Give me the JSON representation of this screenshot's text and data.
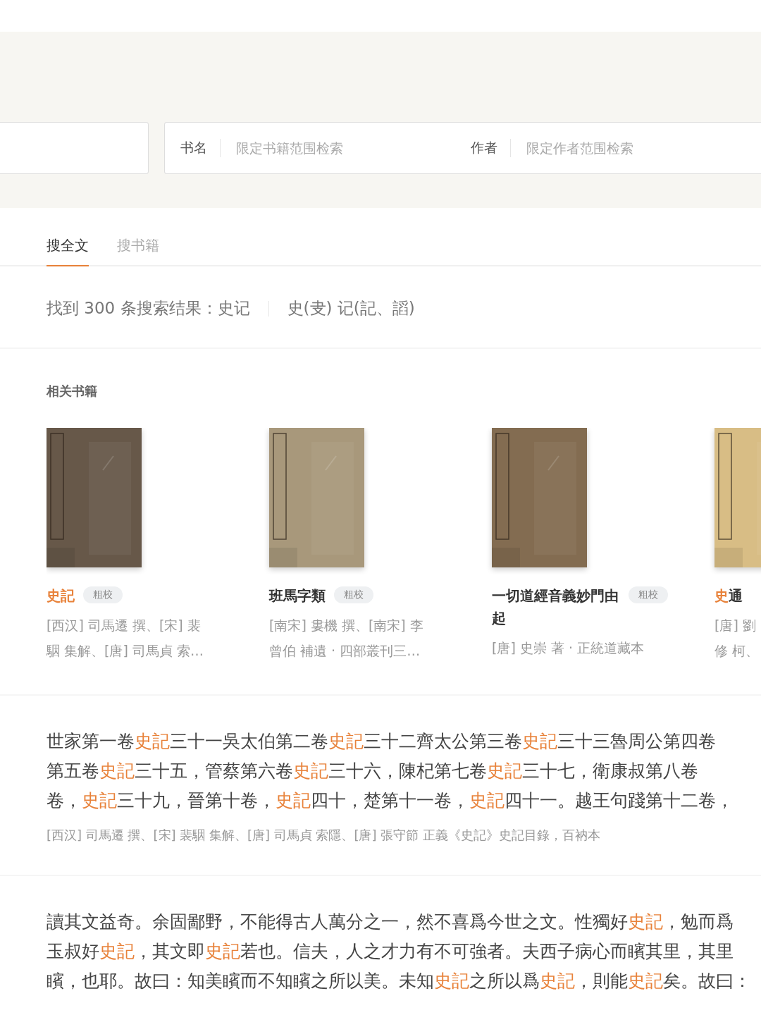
{
  "search": {
    "fields": [
      {
        "label": "书名",
        "placeholder": "限定书籍范围检索"
      },
      {
        "label": "作者",
        "placeholder": "限定作者范围检索"
      }
    ]
  },
  "tabs": [
    {
      "label": "搜全文",
      "selected": true
    },
    {
      "label": "搜书籍",
      "selected": false
    }
  ],
  "summary": {
    "count_text": "找到 300 条搜索结果：史记",
    "variants": "史(叏) 记(記、謟)"
  },
  "related": {
    "title": "相关书籍",
    "books": [
      {
        "cover": {
          "kind": "picture"
        },
        "title": [
          {
            "t": "史記",
            "hl": true
          }
        ],
        "tag": "粗校",
        "authors": [
          "[西汉] 司馬遷 撰、[宋] 裴",
          "駰 集解、[唐] 司馬貞 索…"
        ]
      },
      {
        "cover": {
          "kind": "picture"
        },
        "title": [
          {
            "t": "班馬字類",
            "hl": false
          }
        ],
        "tag": "粗校",
        "authors": [
          "[南宋] 婁機 撰、[南宋] 李",
          "曾伯 補遺 · 四部叢刊三…"
        ]
      },
      {
        "cover": {
          "kind": "picture"
        },
        "title": [
          {
            "t": "一切道經音義妙門由起",
            "hl": false
          }
        ],
        "tag": "粗校",
        "authors": [
          "[唐] 史崇 著 · 正統道藏本"
        ]
      },
      {
        "cover": {
          "kind": "picture"
        },
        "title": [
          {
            "t": "史",
            "hl": true
          },
          {
            "t": "通",
            "hl": false
          }
        ],
        "authors": [
          "[唐] 劉",
          "修 柯、"
        ]
      }
    ]
  },
  "results": [
    {
      "lines": [
        [
          {
            "t": "世家第一卷",
            "hl": false
          },
          {
            "t": "史記",
            "hl": true
          },
          {
            "t": "三十一吳太伯第二卷",
            "hl": false
          },
          {
            "t": "史記",
            "hl": true
          },
          {
            "t": "三十二齊太公第三卷",
            "hl": false
          },
          {
            "t": "史記",
            "hl": true
          },
          {
            "t": "三十三魯周公第四卷",
            "hl": false
          }
        ],
        [
          {
            "t": "第五卷",
            "hl": false
          },
          {
            "t": "史記",
            "hl": true
          },
          {
            "t": "三十五，管蔡第六卷",
            "hl": false
          },
          {
            "t": "史記",
            "hl": true
          },
          {
            "t": "三十六，陳杞第七卷",
            "hl": false
          },
          {
            "t": "史記",
            "hl": true
          },
          {
            "t": "三十七，衛康叔第八卷",
            "hl": false
          }
        ],
        [
          {
            "t": "卷，",
            "hl": false
          },
          {
            "t": "史記",
            "hl": true
          },
          {
            "t": "三十九，晉第十卷，",
            "hl": false
          },
          {
            "t": "史記",
            "hl": true
          },
          {
            "t": "四十，楚第十一卷，",
            "hl": false
          },
          {
            "t": "史記",
            "hl": true
          },
          {
            "t": "四十一。越王句踐第十二卷，",
            "hl": false
          }
        ]
      ],
      "meta": "[西汉] 司馬遷 撰、[宋] 裴駰 集解、[唐] 司馬貞 索隱、[唐] 張守節 正義《史記》史記目錄，百衲本"
    },
    {
      "lines": [
        [
          {
            "t": "讀其文益奇。余固鄙野，不能得古人萬分之一，然不喜爲今世之文。性獨好",
            "hl": false
          },
          {
            "t": "史記",
            "hl": true
          },
          {
            "t": "，勉而爲",
            "hl": false
          }
        ],
        [
          {
            "t": "玉叔好",
            "hl": false
          },
          {
            "t": "史記",
            "hl": true
          },
          {
            "t": "，其文即",
            "hl": false
          },
          {
            "t": "史記",
            "hl": true
          },
          {
            "t": "若也。信夫，人之才力有不可強者。夫西子病心而矉其里，其里",
            "hl": false
          }
        ],
        [
          {
            "t": "矉，也耶。故曰：知美矉而不知矉之所以美。未知",
            "hl": false
          },
          {
            "t": "史記",
            "hl": true
          },
          {
            "t": "之所以爲",
            "hl": false
          },
          {
            "t": "史記",
            "hl": true
          },
          {
            "t": "，則能",
            "hl": false
          },
          {
            "t": "史記",
            "hl": true
          },
          {
            "t": "矣。故曰：",
            "hl": false
          }
        ]
      ]
    }
  ]
}
